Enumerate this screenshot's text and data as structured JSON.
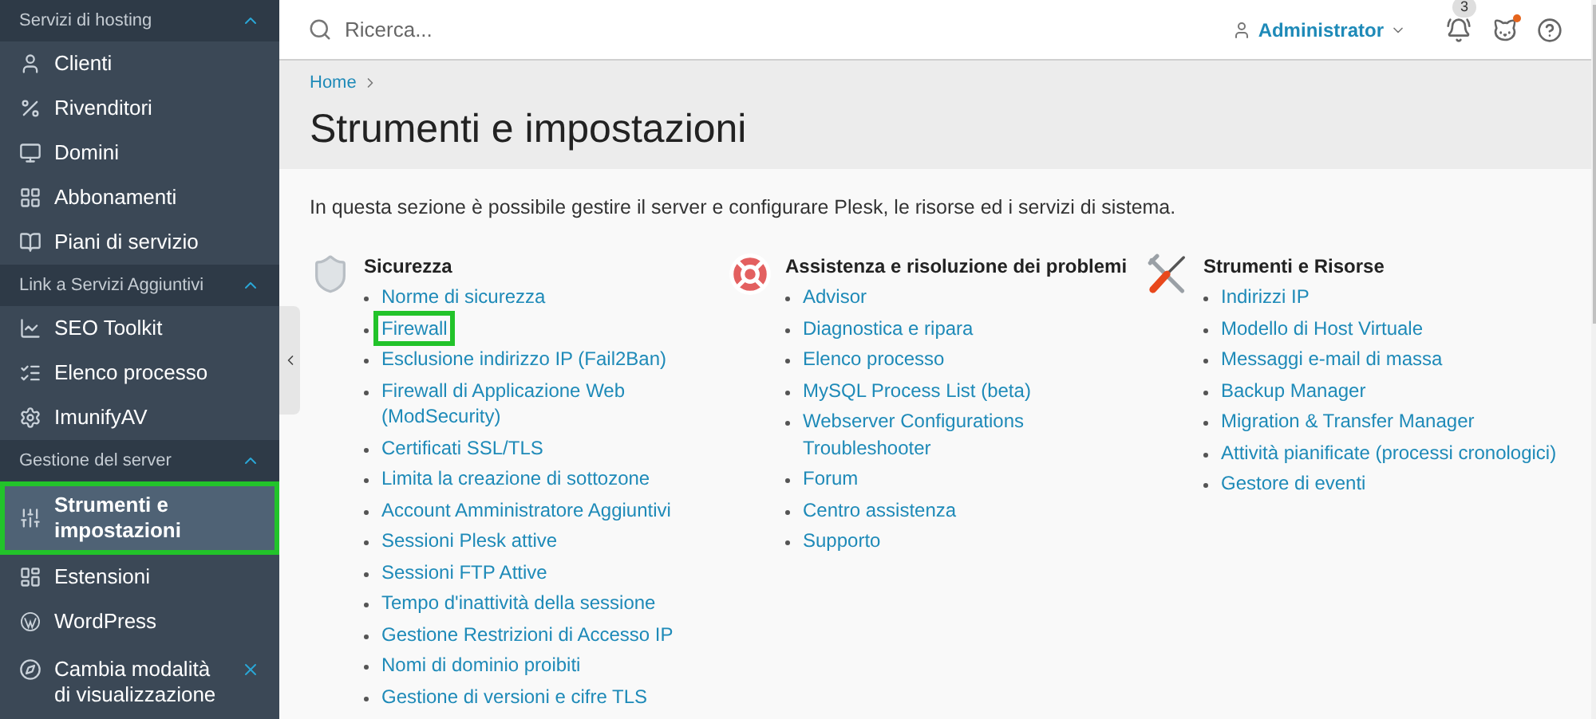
{
  "sidebar": {
    "groups": [
      {
        "title": "Servizi di hosting",
        "expanded": true,
        "items": [
          {
            "label": "Clienti",
            "selected": false,
            "highlighted": false
          },
          {
            "label": "Rivenditori",
            "selected": false,
            "highlighted": false
          },
          {
            "label": "Domini",
            "selected": false,
            "highlighted": false
          },
          {
            "label": "Abbonamenti",
            "selected": false,
            "highlighted": false
          },
          {
            "label": "Piani di servizio",
            "selected": false,
            "highlighted": false
          }
        ]
      },
      {
        "title": "Link a Servizi Aggiuntivi",
        "expanded": true,
        "items": [
          {
            "label": "SEO Toolkit",
            "selected": false,
            "highlighted": false
          },
          {
            "label": "Elenco processo",
            "selected": false,
            "highlighted": false
          },
          {
            "label": "ImunifyAV",
            "selected": false,
            "highlighted": false
          }
        ]
      },
      {
        "title": "Gestione del server",
        "expanded": true,
        "items": [
          {
            "label": "Strumenti e impostazioni",
            "selected": true,
            "highlighted": true
          },
          {
            "label": "Estensioni",
            "selected": false,
            "highlighted": false
          },
          {
            "label": "WordPress",
            "selected": false,
            "highlighted": false
          }
        ]
      }
    ],
    "footer": {
      "label": "Cambia modalità di visualizzazione"
    }
  },
  "header": {
    "search": {
      "placeholder": "Ricerca..."
    },
    "user": "Administrator",
    "notifications": "3",
    "alert": true
  },
  "breadcrumb": [
    "Home"
  ],
  "title": "Strumenti e impostazioni",
  "description": "In questa sezione è possibile gestire il server e configurare Plesk, le risorse ed i servizi di sistema.",
  "sections": [
    {
      "title": "Sicurezza",
      "links": [
        {
          "label": "Norme di sicurezza",
          "highlighted": false
        },
        {
          "label": "Firewall",
          "highlighted": true
        },
        {
          "label": "Esclusione indirizzo IP (Fail2Ban)",
          "highlighted": false
        },
        {
          "label": "Firewall di Applicazione Web (ModSecurity)",
          "highlighted": false
        },
        {
          "label": "Certificati SSL/TLS",
          "highlighted": false
        },
        {
          "label": "Limita la creazione di sottozone",
          "highlighted": false
        },
        {
          "label": "Account Amministratore Aggiuntivi",
          "highlighted": false
        },
        {
          "label": "Sessioni Plesk attive",
          "highlighted": false
        },
        {
          "label": "Sessioni FTP Attive",
          "highlighted": false
        },
        {
          "label": "Tempo d'inattività della sessione",
          "highlighted": false
        },
        {
          "label": "Gestione Restrizioni di Accesso IP",
          "highlighted": false
        },
        {
          "label": "Nomi di dominio proibiti",
          "highlighted": false
        },
        {
          "label": "Gestione di versioni e cifre TLS",
          "highlighted": false
        }
      ]
    },
    {
      "title": "Assistenza e risoluzione dei problemi",
      "links": [
        {
          "label": "Advisor",
          "highlighted": false
        },
        {
          "label": "Diagnostica e ripara",
          "highlighted": false
        },
        {
          "label": "Elenco processo",
          "highlighted": false
        },
        {
          "label": "MySQL Process List (beta)",
          "highlighted": false
        },
        {
          "label": "Webserver Configurations Troubleshooter",
          "highlighted": false
        },
        {
          "label": "Forum",
          "highlighted": false
        },
        {
          "label": "Centro assistenza",
          "highlighted": false
        },
        {
          "label": "Supporto",
          "highlighted": false
        }
      ]
    },
    {
      "title": "Strumenti e Risorse",
      "links": [
        {
          "label": "Indirizzi IP",
          "highlighted": false
        },
        {
          "label": "Modello di Host Virtuale",
          "highlighted": false
        },
        {
          "label": "Messaggi e-mail di massa",
          "highlighted": false
        },
        {
          "label": "Backup Manager",
          "highlighted": false
        },
        {
          "label": "Migration & Transfer Manager",
          "highlighted": false
        },
        {
          "label": "Attività pianificate (processi cronologici)",
          "highlighted": false
        },
        {
          "label": "Gestore di eventi",
          "highlighted": false
        }
      ]
    }
  ]
}
